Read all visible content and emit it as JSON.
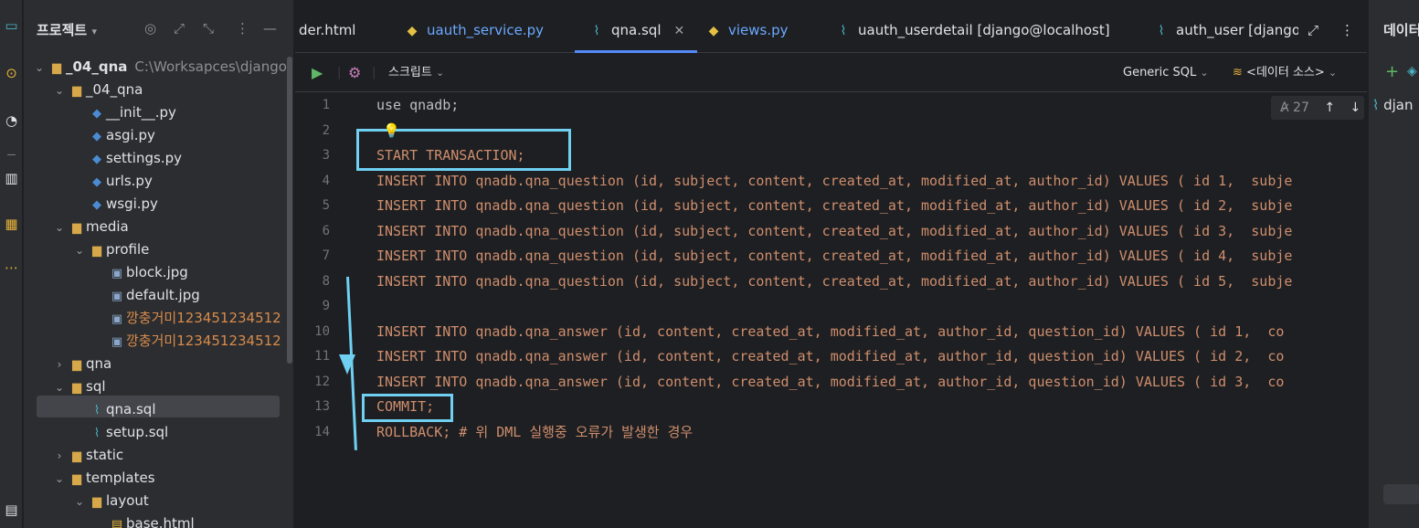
{
  "toolstrip": {
    "icons": [
      "project-icon",
      "commit-icon",
      "vcs-icon",
      "structure-icon",
      "bookmarks-icon",
      "more-icon",
      "database-tool-icon"
    ]
  },
  "project": {
    "title": "프로젝트",
    "tree": [
      {
        "label": "_04_qna",
        "extra": "C:\\Worksapces\\django",
        "icon": "folder-icon",
        "level": 0,
        "expanded": true
      },
      {
        "label": "_04_qna",
        "icon": "folder-icon",
        "level": 1,
        "expanded": true
      },
      {
        "label": "__init__.py",
        "icon": "python-file-icon",
        "level": 2
      },
      {
        "label": "asgi.py",
        "icon": "python-file-icon",
        "level": 2
      },
      {
        "label": "settings.py",
        "icon": "python-file-icon",
        "level": 2
      },
      {
        "label": "urls.py",
        "icon": "python-file-icon",
        "level": 2
      },
      {
        "label": "wsgi.py",
        "icon": "python-file-icon",
        "level": 2
      },
      {
        "label": "media",
        "icon": "folder-icon",
        "level": 1,
        "expanded": true
      },
      {
        "label": "profile",
        "icon": "folder-icon",
        "level": 2,
        "expanded": true
      },
      {
        "label": "block.jpg",
        "icon": "image-file-icon",
        "level": 3
      },
      {
        "label": "default.jpg",
        "icon": "image-file-icon",
        "level": 3
      },
      {
        "label": "깡충거미123451234512",
        "icon": "image-file-icon",
        "level": 3
      },
      {
        "label": "깡충거미123451234512",
        "icon": "image-file-icon",
        "level": 3
      },
      {
        "label": "qna",
        "icon": "folder-icon",
        "level": 1,
        "expanded": false
      },
      {
        "label": "sql",
        "icon": "folder-icon",
        "level": 1,
        "expanded": true
      },
      {
        "label": "qna.sql",
        "icon": "sql-file-icon",
        "level": 2
      },
      {
        "label": "setup.sql",
        "icon": "sql-file-icon",
        "level": 2
      },
      {
        "label": "static",
        "icon": "folder-icon",
        "level": 1,
        "expanded": false
      },
      {
        "label": "templates",
        "icon": "folder-icon",
        "level": 1,
        "expanded": true
      },
      {
        "label": "layout",
        "icon": "folder-icon",
        "level": 2,
        "expanded": true
      },
      {
        "label": "base.html",
        "icon": "html-file-icon",
        "level": 3
      }
    ]
  },
  "tabs": [
    {
      "label": "der.html",
      "icon": "html-file-icon"
    },
    {
      "label": "uauth_service.py",
      "icon": "python-file-icon"
    },
    {
      "label": "qna.sql",
      "icon": "sql-file-icon",
      "active": true
    },
    {
      "label": "views.py",
      "icon": "python-file-icon"
    },
    {
      "label": "uauth_userdetail [django@localhost]",
      "icon": "table-icon"
    },
    {
      "label": "auth_user [django",
      "icon": "table-icon"
    }
  ],
  "toolbar": {
    "script_label": "스크립트",
    "dialect_label": "Generic SQL",
    "datasource_label": "<데이터 소스>",
    "find_count": "27"
  },
  "editor": {
    "lines": [
      "use qnadb;",
      "",
      "START TRANSACTION;",
      "INSERT INTO qnadb.qna_question (id, subject, content, created_at, modified_at, author_id) VALUES ( id 1,  subje",
      "INSERT INTO qnadb.qna_question (id, subject, content, created_at, modified_at, author_id) VALUES ( id 2,  subje",
      "INSERT INTO qnadb.qna_question (id, subject, content, created_at, modified_at, author_id) VALUES ( id 3,  subje",
      "INSERT INTO qnadb.qna_question (id, subject, content, created_at, modified_at, author_id) VALUES ( id 4,  subje",
      "INSERT INTO qnadb.qna_question (id, subject, content, created_at, modified_at, author_id) VALUES ( id 5,  subje",
      "",
      "INSERT INTO qnadb.qna_answer (id, content, created_at, modified_at, author_id, question_id) VALUES ( id 1,  co",
      "INSERT INTO qnadb.qna_answer (id, content, created_at, modified_at, author_id, question_id) VALUES ( id 2,  co",
      "INSERT INTO qnadb.qna_answer (id, content, created_at, modified_at, author_id, question_id) VALUES ( id 3,  co",
      "COMMIT;",
      "ROLLBACK; # 위 DML 실행중 오류가 발생한 경우"
    ],
    "line_numbers": [
      "1",
      "2",
      "3",
      "4",
      "5",
      "6",
      "7",
      "8",
      "9",
      "10",
      "11",
      "12",
      "13",
      "14"
    ]
  },
  "dbpanel": {
    "title": "데이터",
    "item_label": "djan"
  },
  "colors": {
    "background": "#1e1f22",
    "panel": "#2b2d30",
    "keyword": "#cf8e6d",
    "column": "#c77dbb",
    "number": "#2aacb8",
    "highlight": "#6fd0f2",
    "active_tab_accent": "#548af7"
  }
}
